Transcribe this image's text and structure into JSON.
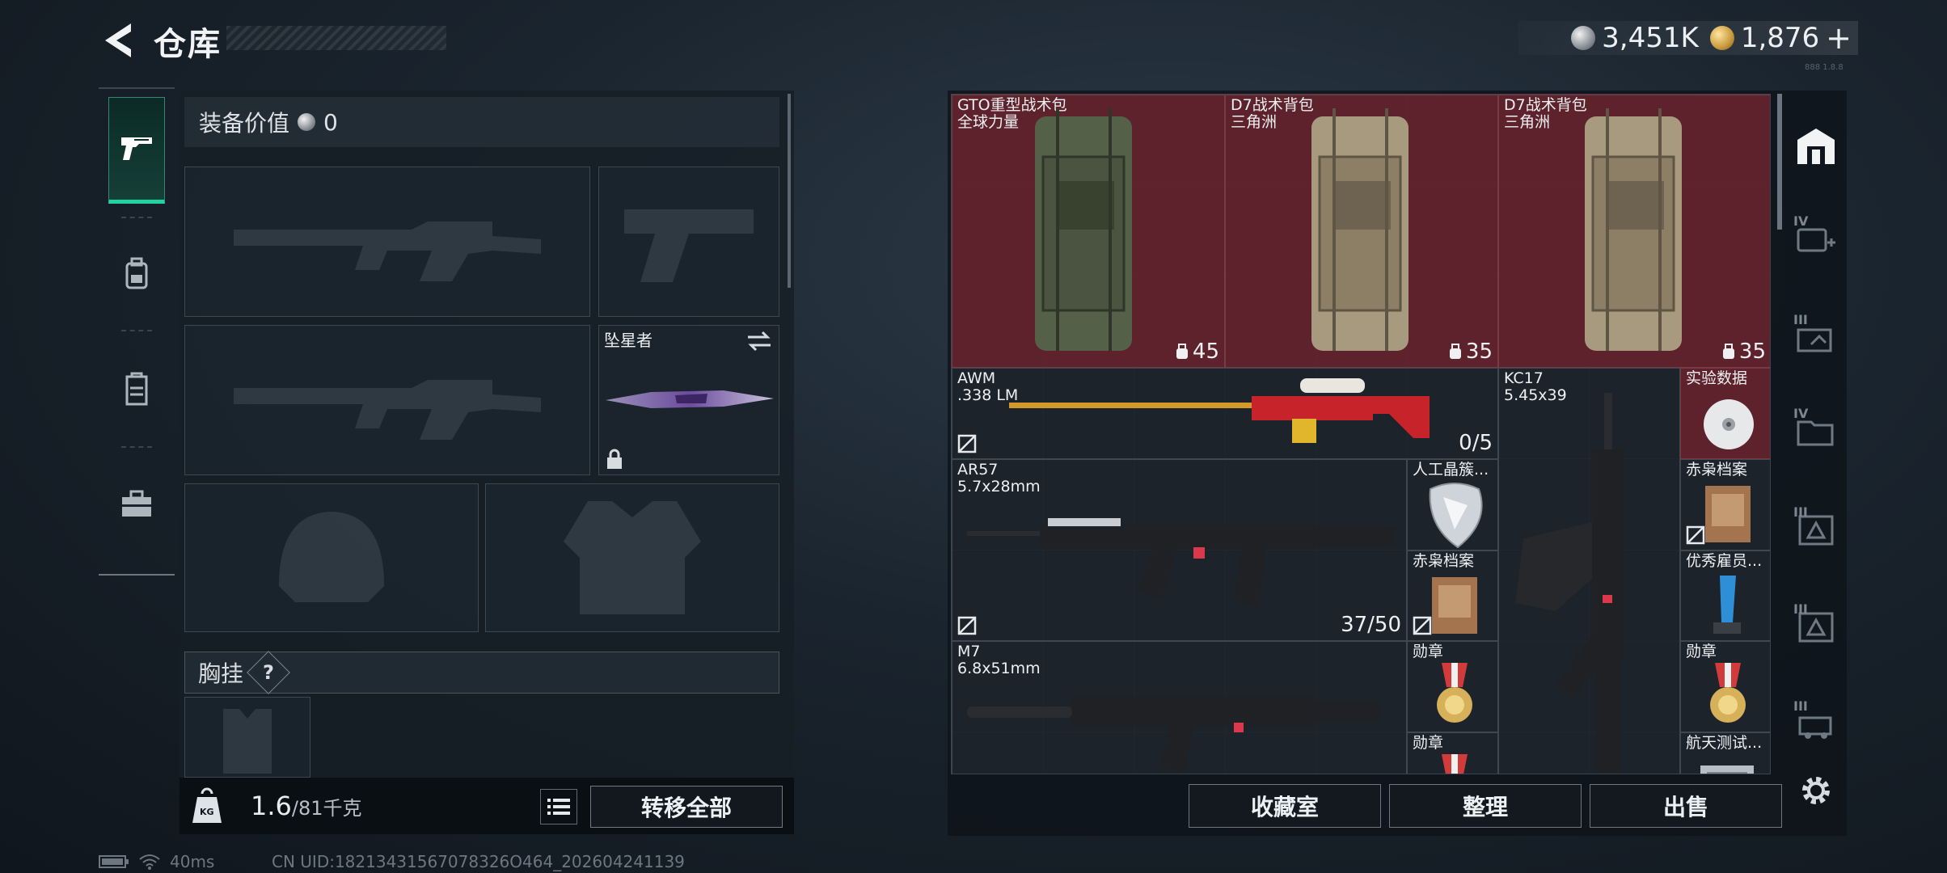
{
  "header": {
    "title": "仓库",
    "currencies": [
      {
        "icon": "silver-coin-icon",
        "value": "3,451K"
      },
      {
        "icon": "gold-coin-icon",
        "value": "1,876"
      }
    ],
    "add_label": "+",
    "server_text": "888 1.8.8"
  },
  "left_rail": {
    "tabs": [
      {
        "icon": "pistol-icon",
        "active": true
      },
      {
        "icon": "backpack-icon",
        "active": false
      },
      {
        "icon": "vest-icon",
        "active": false
      },
      {
        "icon": "briefcase-icon",
        "active": false
      }
    ]
  },
  "equipment": {
    "value_label": "装备价值",
    "value": "0",
    "melee_name": "坠星者",
    "vest_label": "胸挂",
    "help": "?"
  },
  "weight": {
    "icon": "KG",
    "current": "1.6",
    "max": "/81千克"
  },
  "transfer_all": "转移全部",
  "status": {
    "ping": "40ms",
    "uid": "CN UID:18213431567078326O464_202604241139"
  },
  "inventory": {
    "items": [
      {
        "name": "GTO重型战术包",
        "sub": "全球力量",
        "count": "45"
      },
      {
        "name": "D7战术背包",
        "sub": "三角洲",
        "count": "35"
      },
      {
        "name": "D7战术背包",
        "sub": "三角洲",
        "count": "35"
      },
      {
        "name": "AWM",
        "sub": ".338 LM",
        "count": "0/5"
      },
      {
        "name": "KC17",
        "sub": "5.45x39"
      },
      {
        "name": "实验数据"
      },
      {
        "name": "AR57",
        "sub": "5.7x28mm",
        "count": "37/50"
      },
      {
        "name": "人工晶簇..."
      },
      {
        "name": "赤枭档案"
      },
      {
        "name": "赤枭档案"
      },
      {
        "name": "优秀雇员..."
      },
      {
        "name": "M7",
        "sub": "6.8x51mm"
      },
      {
        "name": "勋章"
      },
      {
        "name": "勋章"
      },
      {
        "name": "勋章"
      },
      {
        "name": "航天测试..."
      }
    ]
  },
  "right_rail": {
    "tiers": [
      "IV",
      "III",
      "IV",
      "III",
      "III",
      "III"
    ]
  },
  "actions": {
    "collection": "收藏室",
    "organize": "整理",
    "sell": "出售"
  }
}
